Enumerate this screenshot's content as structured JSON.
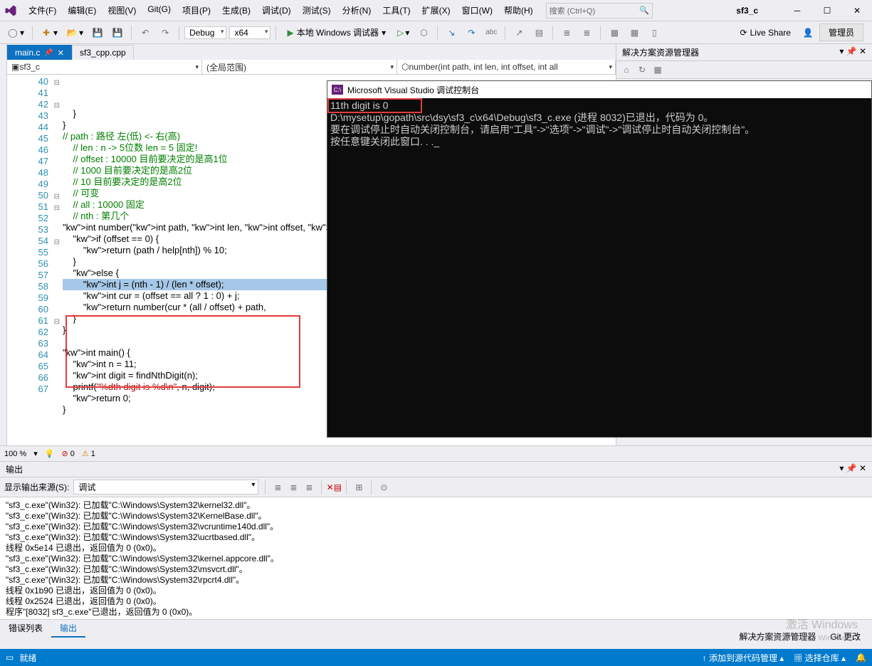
{
  "menus": [
    "文件(F)",
    "编辑(E)",
    "视图(V)",
    "Git(G)",
    "项目(P)",
    "生成(B)",
    "调试(D)",
    "测试(S)",
    "分析(N)",
    "工具(T)",
    "扩展(X)",
    "窗口(W)",
    "帮助(H)"
  ],
  "search_placeholder": "搜索 (Ctrl+Q)",
  "solution_name": "sf3_c",
  "toolbar": {
    "config": "Debug",
    "platform": "x64",
    "run_label": "本地 Windows 调试器",
    "liveshare": "Live Share",
    "admin": "管理员"
  },
  "tabs": [
    {
      "name": "main.c",
      "active": true,
      "pinned": true
    },
    {
      "name": "sf3_cpp.cpp",
      "active": false
    }
  ],
  "nav": {
    "scope": "sf3_c",
    "scope2": "(全局范围)",
    "member": "number(int path, int len, int offset, int all"
  },
  "code_lines": [
    {
      "n": 40,
      "t": "    }",
      "fold": ""
    },
    {
      "n": 41,
      "t": "}"
    },
    {
      "n": 42,
      "t": "// path : 路径 左(低) <- 右(高)",
      "cls": "com",
      "fold": "-"
    },
    {
      "n": 43,
      "t": "    // len : n -> 5位数 len = 5 固定!",
      "cls": "com"
    },
    {
      "n": 44,
      "t": "    // offset : 10000 目前要决定的是高1位",
      "cls": "com"
    },
    {
      "n": 45,
      "t": "    // 1000 目前要决定的是高2位",
      "cls": "com"
    },
    {
      "n": 46,
      "t": "    // 10 目前要决定的是高2位",
      "cls": "com"
    },
    {
      "n": 47,
      "t": "    // 可变",
      "cls": "com"
    },
    {
      "n": 48,
      "t": "    // all : 10000 固定",
      "cls": "com"
    },
    {
      "n": 49,
      "t": "    // nth : 第几个",
      "cls": "com"
    },
    {
      "n": 50,
      "t": "int number(int path, int len, int offset, int all,",
      "kw": true,
      "fold": "-"
    },
    {
      "n": 51,
      "t": "    if (offset == 0) {",
      "kw": true,
      "fold": "-"
    },
    {
      "n": 52,
      "t": "        return (path / help[nth]) % 10;",
      "kw": true
    },
    {
      "n": 53,
      "t": "    }"
    },
    {
      "n": 54,
      "t": "    else {",
      "kw": true,
      "fold": "-"
    },
    {
      "n": 55,
      "t": "        int j = (nth - 1) / (len * offset);",
      "hl": true,
      "kw": true
    },
    {
      "n": 56,
      "t": "        int cur = (offset == all ? 1 : 0) + j;",
      "kw": true
    },
    {
      "n": 57,
      "t": "        return number(cur * (all / offset) + path,",
      "kw": true
    },
    {
      "n": 58,
      "t": "    }"
    },
    {
      "n": 59,
      "t": "}"
    },
    {
      "n": 60,
      "t": ""
    },
    {
      "n": 61,
      "t": "int main() {",
      "kw": true,
      "fold": "-"
    },
    {
      "n": 62,
      "t": "    int n = 11;",
      "kw": true
    },
    {
      "n": 63,
      "t": "    int digit = findNthDigit(n);",
      "kw": true
    },
    {
      "n": 64,
      "t": "    printf(\"%dth digit is %d\\n\", n, digit);",
      "kw": true,
      "str": true
    },
    {
      "n": 65,
      "t": "    return 0;",
      "kw": true
    },
    {
      "n": 66,
      "t": "}"
    },
    {
      "n": 67,
      "t": ""
    }
  ],
  "zoom": {
    "pct": "100 %",
    "errors": "0",
    "warnings": "1"
  },
  "console": {
    "title": "Microsoft Visual Studio 调试控制台",
    "lines": [
      "11th digit is 0",
      "",
      "D:\\mysetup\\gopath\\src\\dsy\\sf3_c\\x64\\Debug\\sf3_c.exe (进程 8032)已退出，代码为 0。",
      "要在调试停止时自动关闭控制台，请启用\"工具\"->\"选项\"->\"调试\"->\"调试停止时自动关闭控制台\"。",
      "按任意键关闭此窗口. . ._"
    ]
  },
  "right_panel": {
    "title": "解决方案资源管理器"
  },
  "output": {
    "title": "输出",
    "source_label": "显示输出来源(S):",
    "source": "调试",
    "lines": [
      "\"sf3_c.exe\"(Win32): 已加载\"C:\\Windows\\System32\\kernel32.dll\"。",
      "\"sf3_c.exe\"(Win32): 已加载\"C:\\Windows\\System32\\KernelBase.dll\"。",
      "\"sf3_c.exe\"(Win32): 已加载\"C:\\Windows\\System32\\vcruntime140d.dll\"。",
      "\"sf3_c.exe\"(Win32): 已加载\"C:\\Windows\\System32\\ucrtbased.dll\"。",
      "线程 0x5e14 已退出，返回值为 0 (0x0)。",
      "\"sf3_c.exe\"(Win32): 已加载\"C:\\Windows\\System32\\kernel.appcore.dll\"。",
      "\"sf3_c.exe\"(Win32): 已加载\"C:\\Windows\\System32\\msvcrt.dll\"。",
      "\"sf3_c.exe\"(Win32): 已加载\"C:\\Windows\\System32\\rpcrt4.dll\"。",
      "线程 0x1b90 已退出，返回值为 0 (0x0)。",
      "线程 0x2524 已退出，返回值为 0 (0x0)。",
      "程序\"[8032] sf3_c.exe\"已退出，返回值为 0 (0x0)。"
    ],
    "tabs": [
      "错误列表",
      "输出"
    ]
  },
  "br_tabs": [
    "解决方案资源管理器",
    "Git 更改"
  ],
  "status": {
    "ready": "就绪",
    "srcctrl": "添加到源代码管理",
    "repo": "选择仓库",
    "bell": ""
  },
  "watermark": {
    "l1": "激活 Windows",
    "l2": "转到\"设置\"以激活 Windows。"
  }
}
